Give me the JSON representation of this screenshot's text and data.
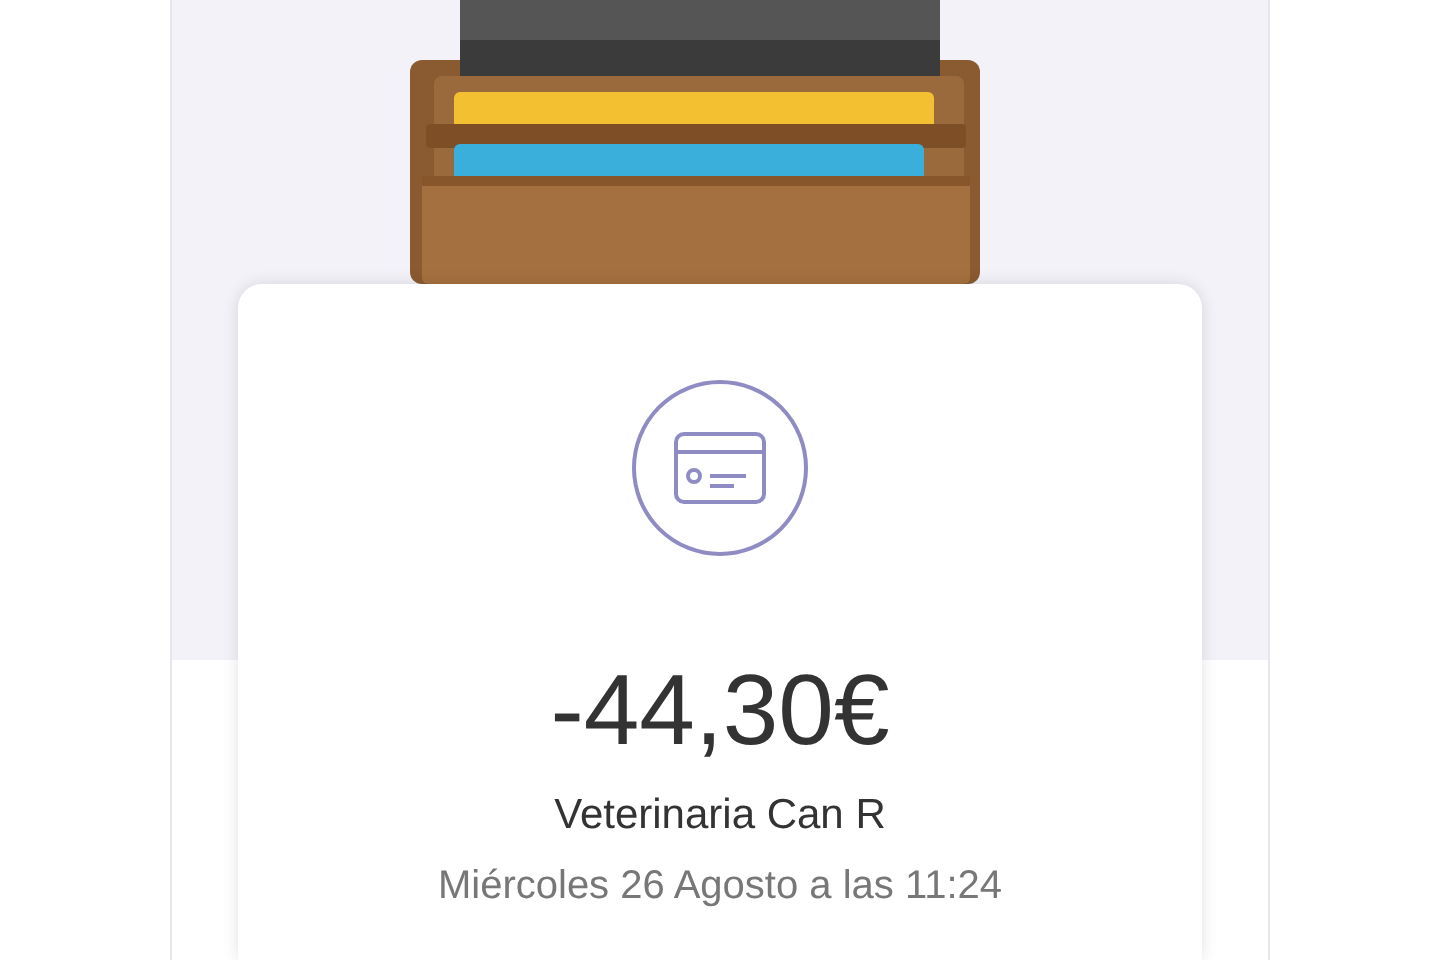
{
  "transaction": {
    "amount": "-44,30€",
    "merchant": "Veterinaria Can R",
    "date": "Miércoles 26 Agosto a las 11:24"
  }
}
